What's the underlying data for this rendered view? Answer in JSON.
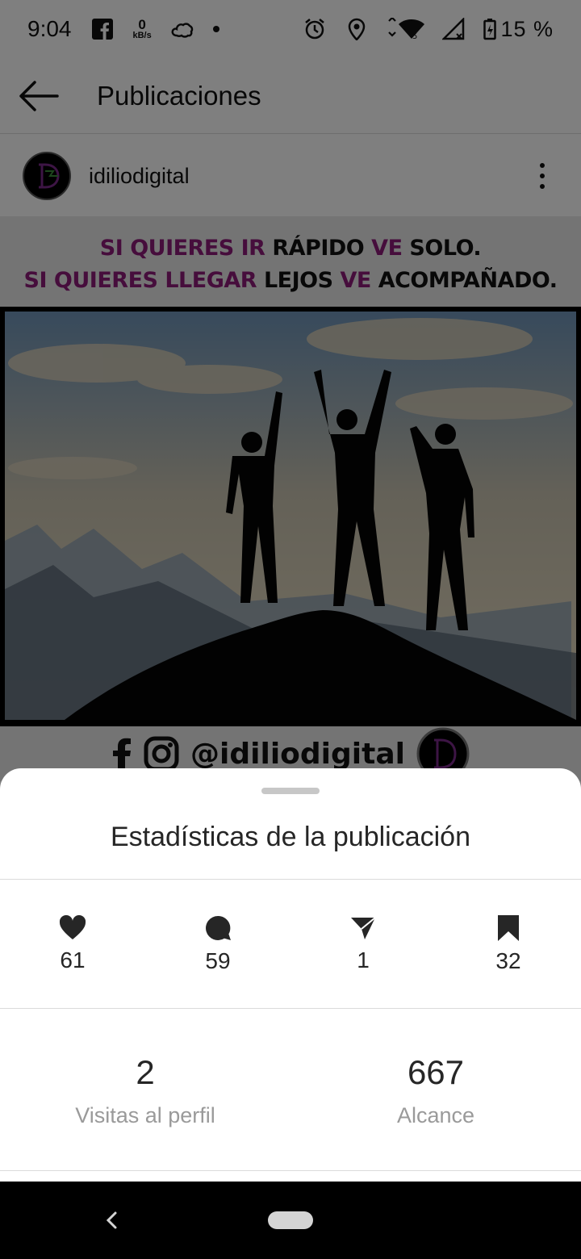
{
  "status_bar": {
    "time": "9:04",
    "net_speed_value": "0",
    "net_speed_unit": "kB/s",
    "battery_percent": "15 %"
  },
  "top_bar": {
    "title": "Publicaciones"
  },
  "post": {
    "username": "idiliodigital",
    "quote": {
      "line1": [
        {
          "text": "SI QUIERES IR ",
          "highlight": true
        },
        {
          "text": "RÁPIDO ",
          "highlight": false
        },
        {
          "text": "VE ",
          "highlight": true
        },
        {
          "text": "SOLO.",
          "highlight": false
        }
      ],
      "line2": [
        {
          "text": "SI QUIERES LLEGAR ",
          "highlight": true
        },
        {
          "text": "LEJOS ",
          "highlight": false
        },
        {
          "text": "VE ",
          "highlight": true
        },
        {
          "text": "ACOMPAÑADO.",
          "highlight": false
        }
      ]
    },
    "footer_handle": "@idiliodigital"
  },
  "sheet": {
    "title": "Estadísticas de la publicación",
    "metrics": [
      {
        "icon": "heart-icon",
        "value": "61"
      },
      {
        "icon": "comment-icon",
        "value": "59"
      },
      {
        "icon": "send-icon",
        "value": "1"
      },
      {
        "icon": "bookmark-icon",
        "value": "32"
      }
    ],
    "stats": [
      {
        "value": "2",
        "label": "Visitas al perfil"
      },
      {
        "value": "667",
        "label": "Alcance"
      }
    ]
  },
  "colors": {
    "quote_highlight": "#8c1a79",
    "sheet_background": "#ffffff",
    "muted_text": "#9a9a9a"
  }
}
